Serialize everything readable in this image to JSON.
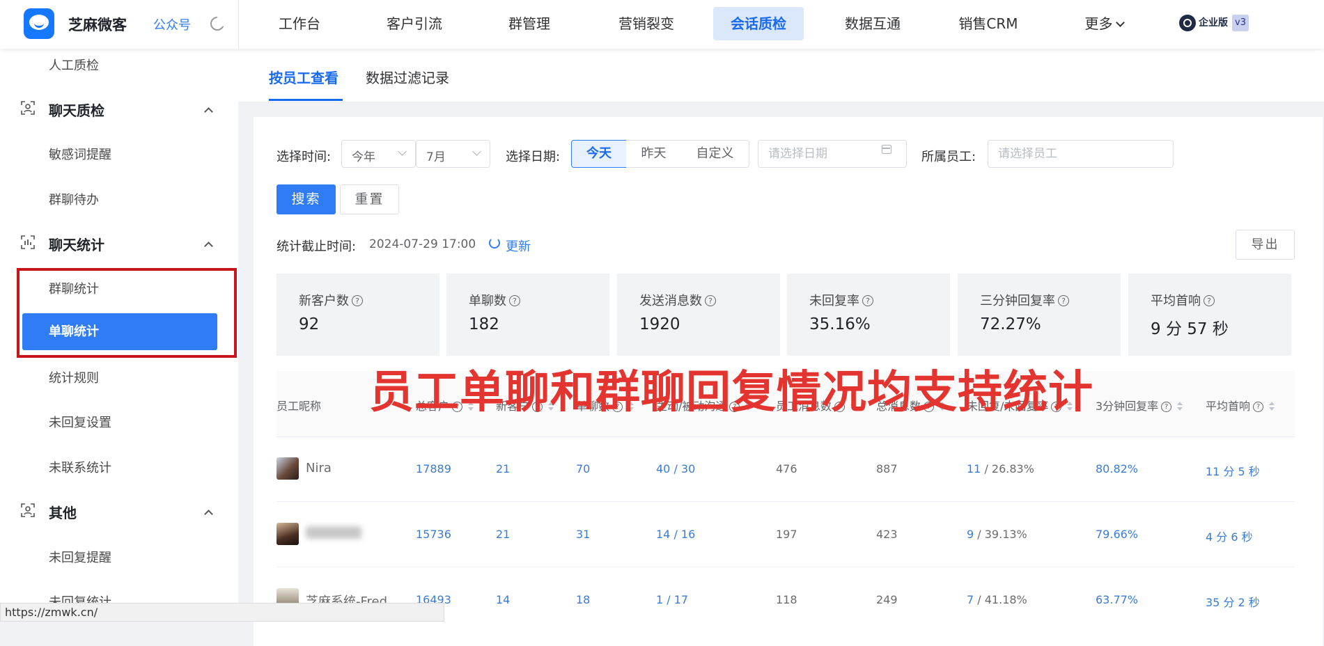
{
  "header": {
    "brand": "芝麻微客",
    "gzh": "公众号",
    "nav": [
      "工作台",
      "客户引流",
      "群管理",
      "营销裂变",
      "会话质检",
      "数据互通",
      "销售CRM",
      "更多"
    ],
    "active_nav": "会话质检",
    "edition_label": "企业版",
    "edition_version": "v3"
  },
  "sidebar": {
    "item_top": "人工质检",
    "group1": {
      "title": "聊天质检",
      "items": [
        "敏感词提醒",
        "群聊待办"
      ]
    },
    "group2": {
      "title": "聊天统计",
      "items": [
        "群聊统计",
        "单聊统计",
        "统计规则",
        "未回复设置",
        "未联系统计"
      ],
      "active": "单聊统计"
    },
    "group3": {
      "title": "其他",
      "items": [
        "未回复提醒",
        "未回复统计"
      ]
    }
  },
  "tabs": [
    "按员工查看",
    "数据过滤记录"
  ],
  "filters": {
    "time_label": "选择时间:",
    "year_value": "今年",
    "month_value": "7月",
    "date_label": "选择日期:",
    "date_options": [
      "今天",
      "昨天",
      "自定义"
    ],
    "date_selected": "今天",
    "date_placeholder": "请选择日期",
    "employee_label": "所属员工:",
    "employee_placeholder": "请选择员工",
    "search_btn": "搜索",
    "reset_btn": "重置"
  },
  "stats": {
    "cutoff_label": "统计截止时间:",
    "cutoff_time": "2024-07-29 17:00",
    "refresh": "更新",
    "export": "导出",
    "cards": [
      {
        "title": "新客户数",
        "value": "92"
      },
      {
        "title": "单聊数",
        "value": "182"
      },
      {
        "title": "发送消息数",
        "value": "1920"
      },
      {
        "title": "未回复率",
        "value": "35.16%"
      },
      {
        "title": "三分钟回复率",
        "value": "72.27%"
      },
      {
        "title": "平均首响",
        "value": "9 分 57 秒"
      }
    ]
  },
  "overlay_text": "员工单聊和群聊回复情况均支持统计",
  "table": {
    "headers": [
      "员工昵称",
      "总客户",
      "新客户",
      "单聊数",
      "主动/被动沟通",
      "员工消息数",
      "总消息数",
      "未回复/未回复率",
      "3分钟回复率",
      "平均首响"
    ],
    "rows": [
      {
        "name": "Nira",
        "total": "17889",
        "new": "21",
        "chats": "70",
        "active_passive": "40 / 30",
        "staff_msgs": "476",
        "total_msgs": "887",
        "unreplied": "11",
        "unreplied_rate": " / 26.83%",
        "rate3": "80.82%",
        "first": "11 分 5 秒"
      },
      {
        "name": "",
        "total": "15736",
        "new": "21",
        "chats": "31",
        "active_passive": "14 / 16",
        "staff_msgs": "197",
        "total_msgs": "423",
        "unreplied": "9",
        "unreplied_rate": " / 39.13%",
        "rate3": "79.66%",
        "first": "4 分 6 秒"
      },
      {
        "name": "芝麻系统-Fred",
        "total": "16493",
        "new": "14",
        "chats": "18",
        "active_passive": "1 / 17",
        "staff_msgs": "118",
        "total_msgs": "249",
        "unreplied": "7",
        "unreplied_rate": " / 41.18%",
        "rate3": "63.77%",
        "first": "35 分 2 秒"
      }
    ]
  },
  "status_url": "https://zmwk.cn/",
  "colors": {
    "primary": "#2f7cf6",
    "highlight_red": "#e3342f",
    "box_red": "#c8161d"
  }
}
